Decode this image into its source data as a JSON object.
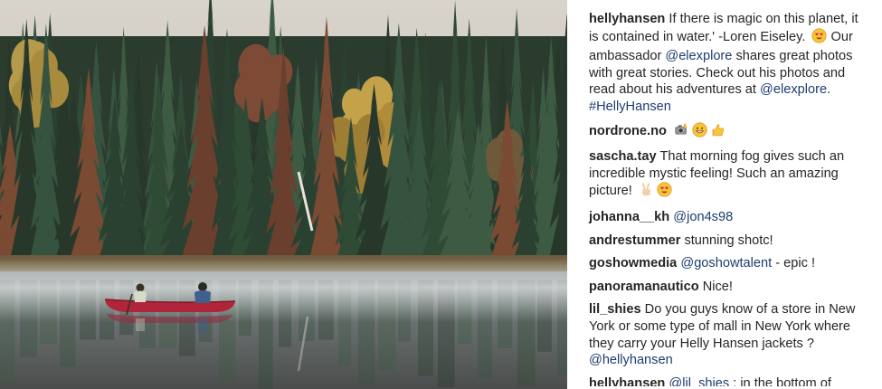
{
  "post": {
    "image_alt": "",
    "comments": [
      {
        "user": "hellyhansen",
        "parts": [
          {
            "t": " If there is magic on this planet, it is contained in water.' -Loren Eiseley. "
          },
          {
            "e": "heart-eyes-emoji"
          },
          {
            "t": " Our ambassador "
          },
          {
            "tag": "@elexplore"
          },
          {
            "t": " shares great photos with great stories. Check out his photos and read about his adventures at "
          },
          {
            "tag": "@elexplore"
          },
          {
            "t": ". "
          },
          {
            "tag": "#HellyHansen"
          }
        ]
      },
      {
        "user": "nordrone.no",
        "parts": [
          {
            "t": " "
          },
          {
            "e": "camera-flash-emoji"
          },
          {
            "e": "grin-emoji"
          },
          {
            "e": "thumbs-up-emoji"
          }
        ]
      },
      {
        "user": "sascha.tay",
        "parts": [
          {
            "t": " That morning fog gives such an incredible mystic feeling! Such an amazing picture! "
          },
          {
            "e": "victory-hand-emoji"
          },
          {
            "e": "heart-eyes-emoji"
          }
        ]
      },
      {
        "user": "johanna__kh",
        "parts": [
          {
            "t": " "
          },
          {
            "tag": "@jon4s98"
          }
        ]
      },
      {
        "user": "andrestummer",
        "parts": [
          {
            "t": " stunning shotc!"
          }
        ]
      },
      {
        "user": "goshowmedia",
        "parts": [
          {
            "t": " "
          },
          {
            "tag": "@goshowtalent"
          },
          {
            "t": " - epic !"
          }
        ]
      },
      {
        "user": "panoramanautico",
        "parts": [
          {
            "t": " Nice!"
          }
        ]
      },
      {
        "user": "lil_shies",
        "parts": [
          {
            "t": " Do you guys know of a store in New York or some type of mall in New York where they carry your Helly Hansen jackets ? "
          },
          {
            "tag": "@hellyhansen"
          }
        ]
      },
      {
        "user": "hellyhansen",
        "parts": [
          {
            "t": " "
          },
          {
            "tag": "@lil_shies"
          },
          {
            "t": " : in the bottom of"
          }
        ]
      }
    ]
  },
  "colors": {
    "username": "#262626",
    "link": "#1d3c6e",
    "canoe": "#b0253a"
  }
}
